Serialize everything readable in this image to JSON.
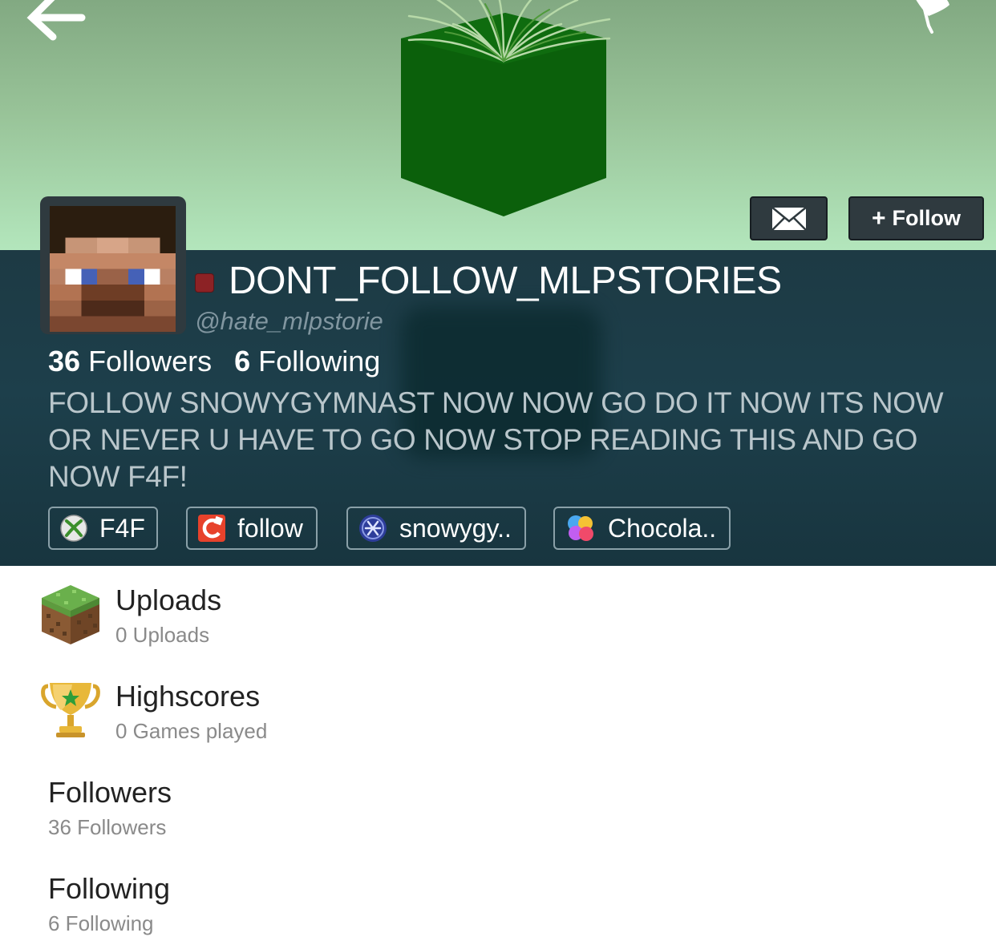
{
  "header": {
    "back_icon": "back-arrow-icon",
    "pin_icon": "pin-icon",
    "mail_icon": "envelope-icon",
    "follow_plus": "+",
    "follow_label": "Follow"
  },
  "profile": {
    "username": "DONT_FOLLOW_MLPSTORIES",
    "handle": "@hate_mlpstorie",
    "status_color": "#8c2225",
    "followers_count": "36",
    "followers_label": "Followers",
    "following_count": "6",
    "following_label": "Following",
    "bio": "FOLLOW SNOWYGYMNAST NOW NOW GO DO IT NOW ITS NOW OR NEVER U HAVE TO GO NOW STOP READING THIS AND GO NOW F4F!",
    "tags": [
      {
        "icon": "xbox-icon",
        "label": "F4F"
      },
      {
        "icon": "kik-icon",
        "label": "follow"
      },
      {
        "icon": "playstation-network-icon",
        "label": "snowygy.."
      },
      {
        "icon": "game-center-icon",
        "label": "Chocola.."
      }
    ]
  },
  "sections": [
    {
      "icon": "grass-block-icon",
      "title": "Uploads",
      "subtitle": "0 Uploads"
    },
    {
      "icon": "trophy-icon",
      "title": "Highscores",
      "subtitle": "0 Games played"
    },
    {
      "title": "Followers",
      "subtitle": "36 Followers"
    },
    {
      "title": "Following",
      "subtitle": "6 Following"
    }
  ],
  "colors": {
    "banner_top": "#82a982",
    "banner_bottom": "#b3e6bc",
    "profile_bg": "#1d3a44",
    "button_bg": "#2f3a3f"
  }
}
